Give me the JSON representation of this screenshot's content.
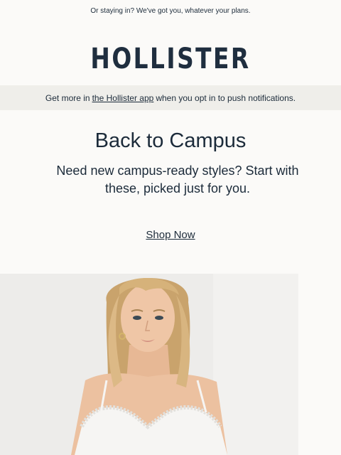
{
  "preheader": {
    "text": "Or staying in? We've got you, whatever your plans."
  },
  "brand": {
    "logo_text": "HOLLISTER"
  },
  "app_bar": {
    "prefix": "Get more in",
    "link_text": "the Hollister app",
    "suffix": "when you opt in to push notifications."
  },
  "hero_copy": {
    "headline": "Back to Campus",
    "subhead": "Need new campus-ready styles? Start with these, picked just for you.",
    "cta_label": "Shop Now"
  },
  "colors": {
    "text": "#1c2b3a",
    "background": "#fbfaf8",
    "app_bar_bg": "#efeeea"
  }
}
